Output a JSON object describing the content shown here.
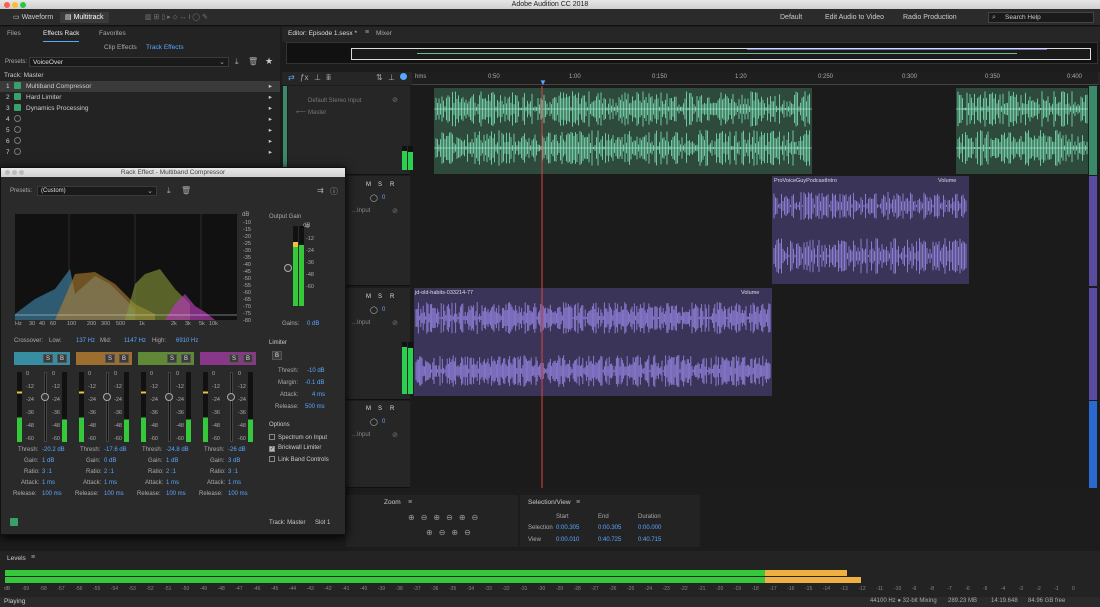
{
  "app": {
    "title": "Adobe Audition CC 2018"
  },
  "toolbar": {
    "waveform": "Waveform",
    "multitrack": "Multitrack",
    "workspaces": [
      "Default",
      "Edit Audio to Video",
      "Radio Production"
    ],
    "search_placeholder": "Search Help"
  },
  "left_tabs": {
    "files": "Files",
    "effects_rack": "Effects Rack",
    "favorites": "Favorites"
  },
  "sub_tabs": {
    "clip": "Clip Effects",
    "track": "Track Effects"
  },
  "presets": {
    "label": "Presets:",
    "value": "VoiceOver"
  },
  "track_master": "Track: Master",
  "effects": [
    {
      "num": "1",
      "name": "Multiband Compressor"
    },
    {
      "num": "2",
      "name": "Hard Limiter"
    },
    {
      "num": "3",
      "name": "Dynamics Processing"
    },
    {
      "num": "4",
      "name": ""
    },
    {
      "num": "5",
      "name": ""
    },
    {
      "num": "6",
      "name": ""
    },
    {
      "num": "7",
      "name": ""
    }
  ],
  "dialog": {
    "title": "Rack Effect - Multiband Compressor",
    "presets_label": "Presets:",
    "presets_value": "(Custom)",
    "db_label": "dB",
    "db_scale": [
      "-10",
      "-15",
      "-20",
      "-25",
      "-30",
      "-35",
      "-40",
      "-45",
      "-50",
      "-55",
      "-60",
      "-65",
      "-70",
      "-75",
      "-80"
    ],
    "hz_scale": [
      "Hz",
      "30",
      "40",
      "60",
      "100",
      "200",
      "300",
      "500",
      "1k",
      "2k",
      "3k",
      "5k",
      "10k"
    ],
    "output_gain": "Output Gain",
    "output_db": "dB",
    "output_scale": [
      "0",
      "-12",
      "-24",
      "-36",
      "-48",
      "-60"
    ],
    "gain_label": "Gains:",
    "gain_value": "0 dB",
    "crossover_label": "Crossover:",
    "low_label": "Low:",
    "low_value": "137 Hz",
    "mid_label": "Mid:",
    "mid_value": "1147 Hz",
    "high_label": "High:",
    "high_value": "6910 Hz",
    "limiter": "Limiter",
    "limiter_b": "B",
    "limiter_rows": [
      {
        "label": "Thresh:",
        "value": "-10 dB"
      },
      {
        "label": "Margin:",
        "value": "-0.1 dB"
      },
      {
        "label": "Attack:",
        "value": "4 ms"
      },
      {
        "label": "Release:",
        "value": "500 ms"
      }
    ],
    "options": "Options",
    "opt_rows": [
      {
        "label": "Spectrum on Input",
        "checked": false
      },
      {
        "label": "Brickwall Limiter",
        "checked": true
      },
      {
        "label": "Link Band Controls",
        "checked": false
      }
    ],
    "band_scale": [
      "0",
      "-12",
      "-24",
      "-36",
      "-48",
      "-60"
    ],
    "bands": [
      {
        "color": "#3aa0b8",
        "thresh": "-20.2 dB",
        "gain": "1 dB",
        "ratio": "3 :1",
        "attack": "1 ms",
        "release": "100 ms"
      },
      {
        "color": "#b07a30",
        "thresh": "-17.6 dB",
        "gain": "0 dB",
        "ratio": "2 :1",
        "attack": "1 ms",
        "release": "100 ms"
      },
      {
        "color": "#6a9a3a",
        "thresh": "-24.8 dB",
        "gain": "1 dB",
        "ratio": "2 :1",
        "attack": "1 ms",
        "release": "100 ms"
      },
      {
        "color": "#9a3a9a",
        "thresh": "-26 dB",
        "gain": "3 dB",
        "ratio": "3 :1",
        "attack": "1 ms",
        "release": "100 ms"
      }
    ],
    "band_labels": {
      "thresh": "Thresh:",
      "gain": "Gain:",
      "ratio": "Ratio:",
      "attack": "Attack:",
      "release": "Release:"
    },
    "s_label": "S",
    "b_label": "B",
    "track_label": "Track: Master",
    "slot_label": "Slot 1"
  },
  "editor": {
    "tab": "Editor: Episode 1.sesx *",
    "mixer": "Mixer"
  },
  "tracks": [
    {
      "input": "Default Stereo Input",
      "output": "Master"
    },
    {
      "input": "...Input",
      "output": ""
    },
    {
      "input": "...Input",
      "output": ""
    },
    {
      "input": "...Input",
      "output": ""
    }
  ],
  "track_ctrl": {
    "m": "M",
    "s": "S",
    "r": "R",
    "vol": "0"
  },
  "ruler": {
    "marks": [
      "hms",
      "0:50",
      "1:00",
      "0:150",
      "1:20",
      "0:250",
      "0:300",
      "0:350",
      "0:400"
    ]
  },
  "clips": [
    {
      "name": "ProVoiceGuyPodcastIntro",
      "label": "Volume"
    },
    {
      "name": "jd-old-habits-033214-77",
      "label": "Volume"
    }
  ],
  "zoom": {
    "title": "Zoom"
  },
  "selview": {
    "title": "Selection/View",
    "headers": [
      "Start",
      "End",
      "Duration"
    ],
    "rows": [
      {
        "label": "Selection",
        "start": "0:00.305",
        "end": "0:00.305",
        "dur": "0:00.000"
      },
      {
        "label": "View",
        "start": "0:00.010",
        "end": "0:40.725",
        "dur": "0:40.715"
      }
    ]
  },
  "timecode": "0:07.01",
  "levels": {
    "title": "Levels",
    "scale": [
      "dB",
      "-59",
      "-58",
      "-57",
      "-56",
      "-55",
      "-54",
      "-53",
      "-52",
      "-51",
      "-50",
      "-49",
      "-48",
      "-47",
      "-46",
      "-45",
      "-44",
      "-43",
      "-42",
      "-41",
      "-40",
      "-39",
      "-38",
      "-37",
      "-36",
      "-35",
      "-34",
      "-33",
      "-32",
      "-31",
      "-30",
      "-29",
      "-28",
      "-27",
      "-26",
      "-25",
      "-24",
      "-23",
      "-22",
      "-21",
      "-20",
      "-19",
      "-18",
      "-17",
      "-16",
      "-15",
      "-14",
      "-13",
      "-12",
      "-11",
      "-10",
      "-9",
      "-8",
      "-7",
      "-6",
      "-5",
      "-4",
      "-3",
      "-2",
      "-1",
      "0"
    ]
  },
  "status": {
    "left": "Playing",
    "sample": "44100 Hz ● 32-bit Mixing",
    "size": "289.23 MB",
    "dur": "14:19.648",
    "free": "84.96 GB free"
  }
}
